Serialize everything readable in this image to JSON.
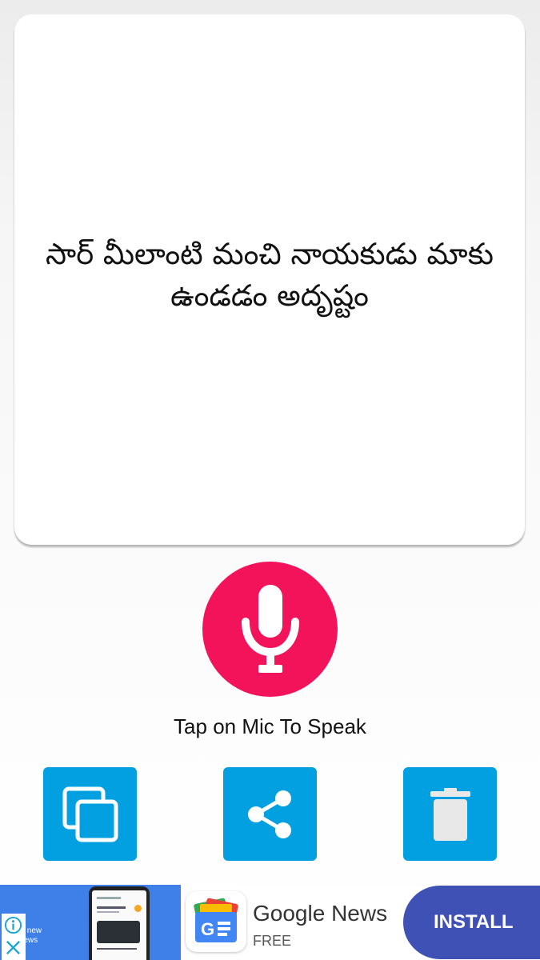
{
  "result": {
    "text": "సార్ మీలాంటి మంచి నాయకుడు మాకు ఉండడం అదృష్టం"
  },
  "mic": {
    "hint": "Tap on Mic To Speak",
    "icon": "microphone-icon",
    "color": "#f2135a"
  },
  "actions": [
    {
      "name": "copy",
      "icon": "copy-icon"
    },
    {
      "name": "share",
      "icon": "share-icon"
    },
    {
      "name": "delete",
      "icon": "trash-icon"
    }
  ],
  "accent_color": "#02a0e0",
  "ad": {
    "promo_text": "Get the new Google News",
    "promo_visible": "et the new\ngle News",
    "app_name": "Google News",
    "price": "FREE",
    "install_label": "INSTALL",
    "install_color": "#3f51b5"
  }
}
